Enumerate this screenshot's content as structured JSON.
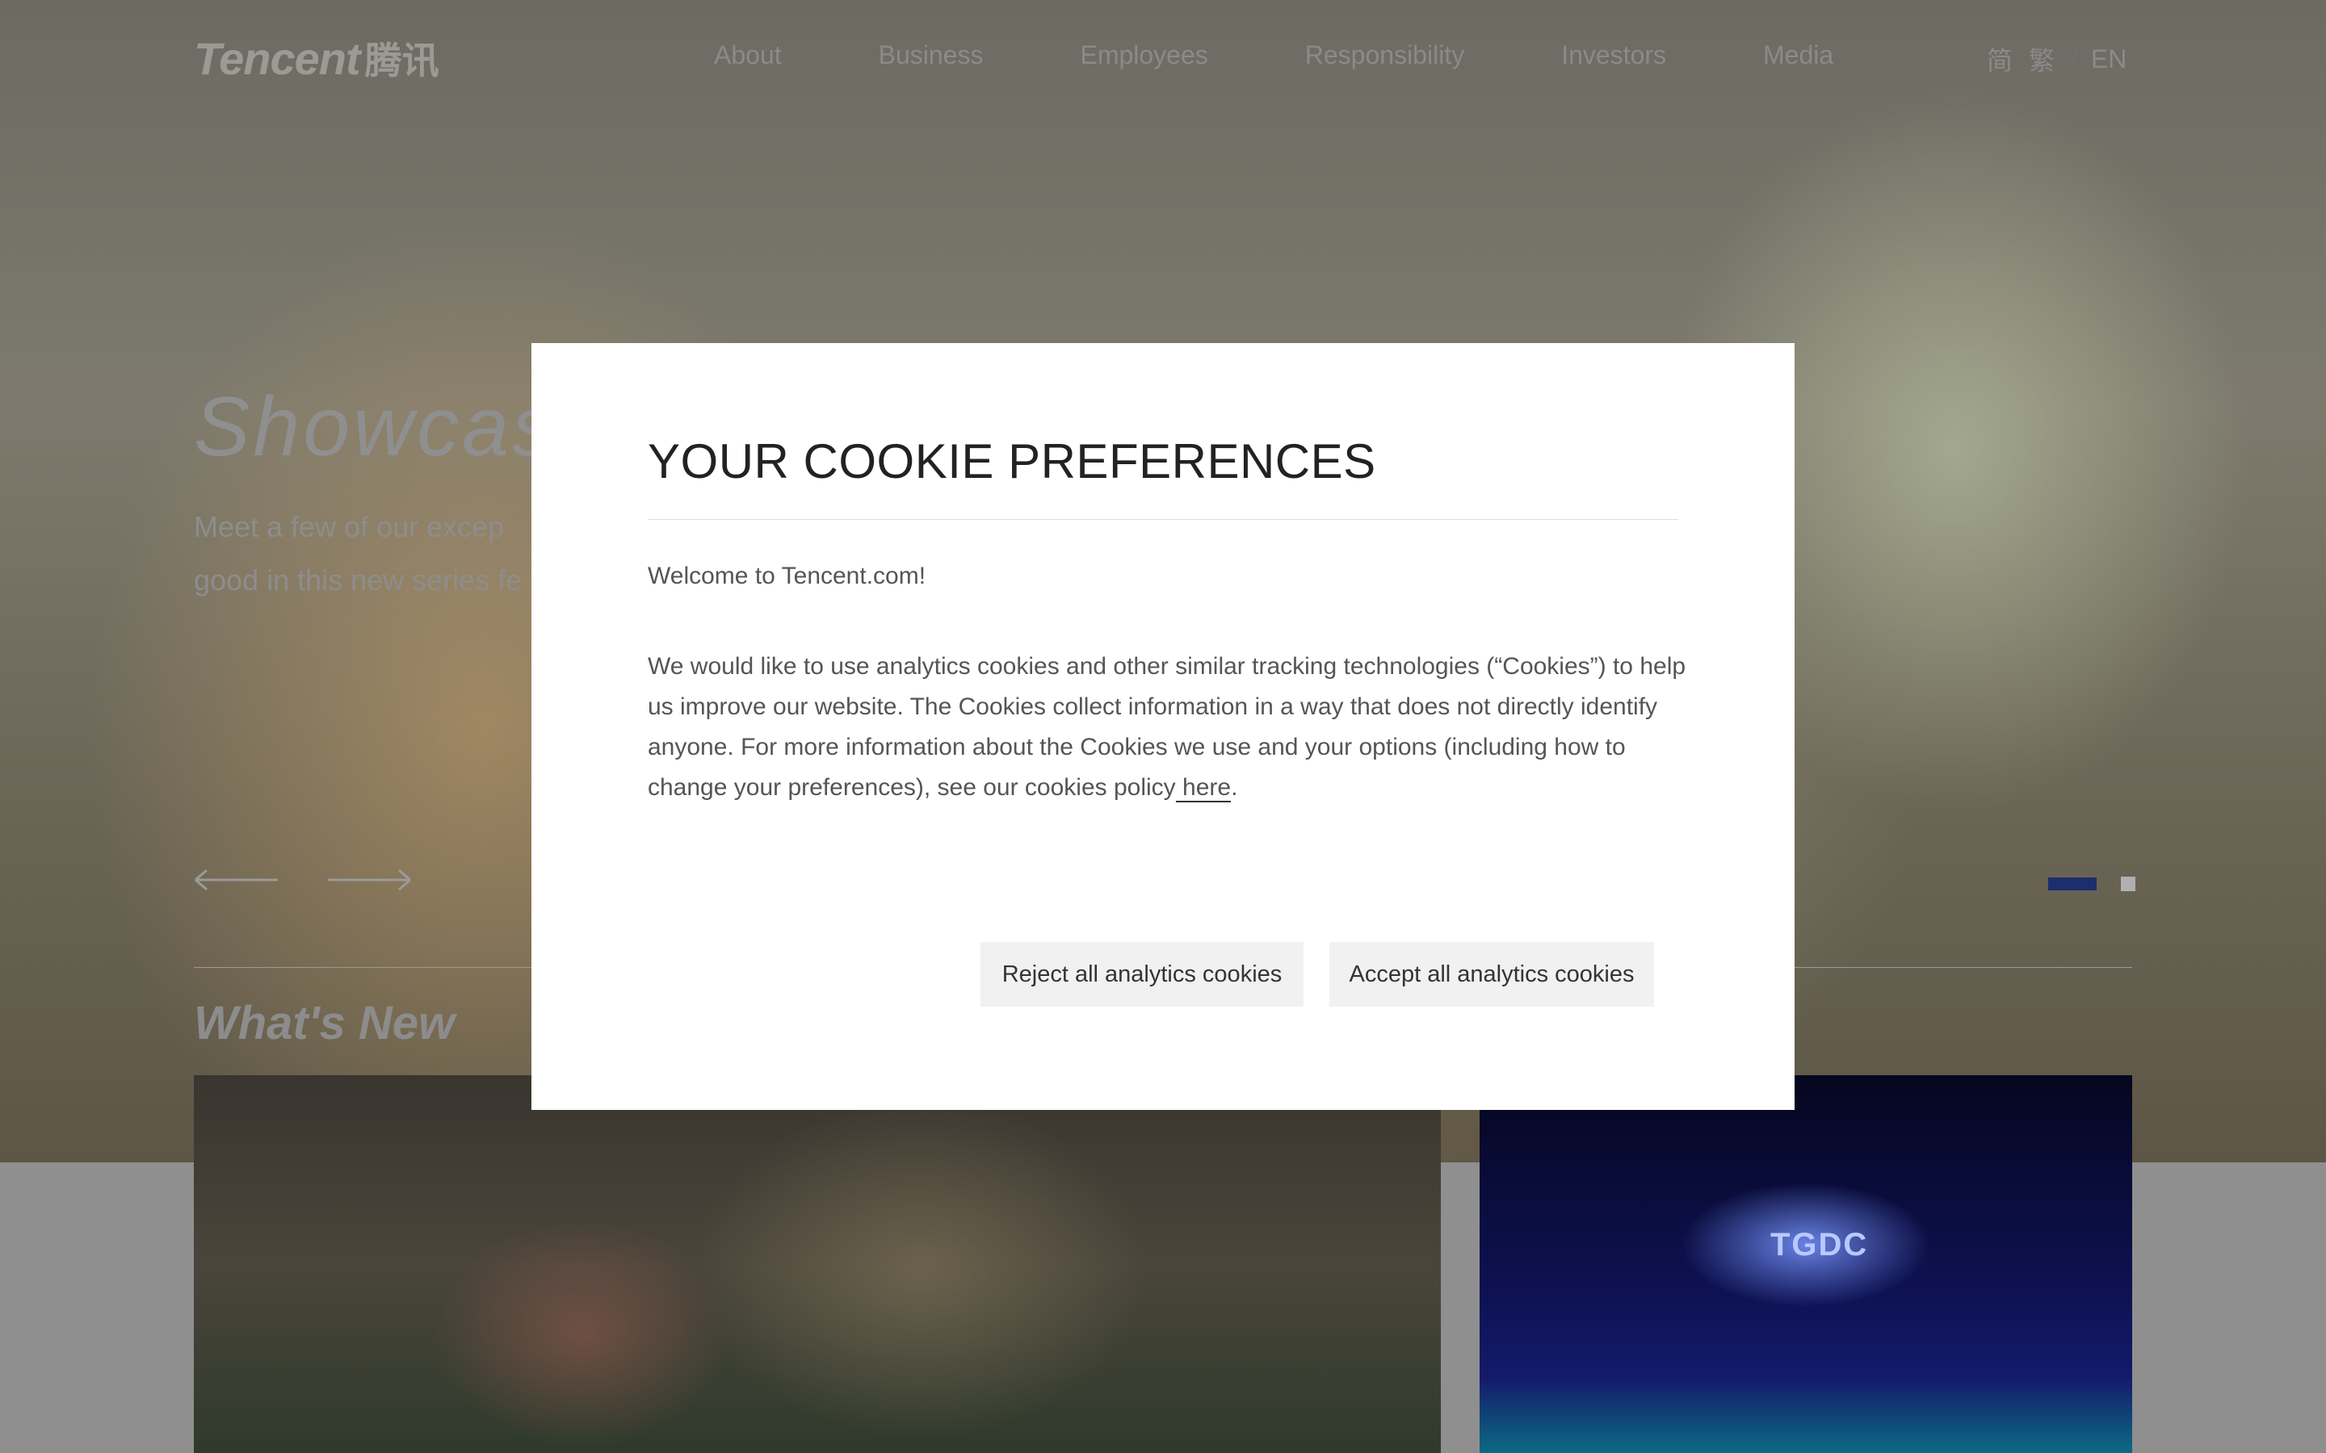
{
  "header": {
    "logo_text": "Tencent",
    "logo_cn": "腾讯",
    "nav": [
      "About",
      "Business",
      "Employees",
      "Responsibility",
      "Investors",
      "Media"
    ],
    "lang": {
      "simplified": "简",
      "traditional": "繁",
      "separator": "/",
      "english": "EN"
    }
  },
  "hero": {
    "title": "Showcasi",
    "subtitle_line1": "Meet a few of our excep",
    "subtitle_line2": "good in this new series fe"
  },
  "section": {
    "whats_new": "What's New"
  },
  "cards": {
    "right_badge": "TGDC"
  },
  "cookie_modal": {
    "title": "YOUR COOKIE PREFERENCES",
    "welcome": "Welcome to Tencent.com!",
    "body": "We would like to use analytics cookies and other similar tracking technologies (“Cookies”) to help us improve our website. The Cookies collect information in a way that does not directly identify anyone. For more information about the Cookies we use and your options (including how to change your preferences), see our cookies policy",
    "link_text": " here",
    "body_end": ".",
    "reject_label": "Reject all analytics cookies",
    "accept_label": "Accept all analytics cookies"
  },
  "colors": {
    "pager_active": "#1b2f6e",
    "modal_bg": "#ffffff",
    "button_bg": "#f1f1f1"
  },
  "icons": {
    "prev": "arrow-left-icon",
    "next": "arrow-right-icon"
  }
}
